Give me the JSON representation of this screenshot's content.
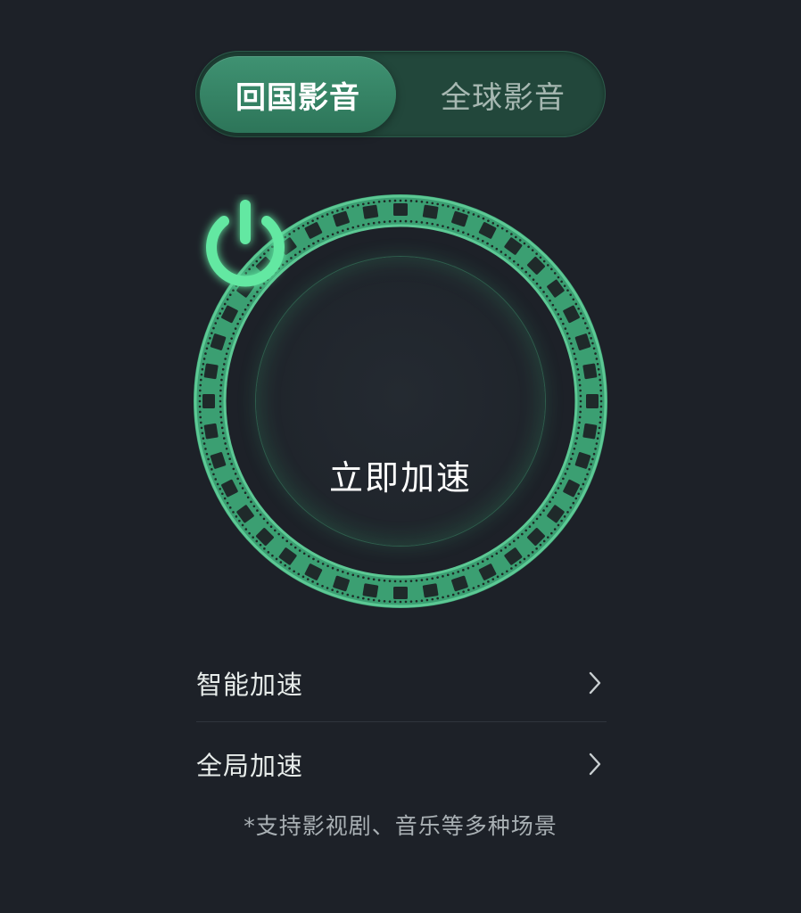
{
  "segmented": {
    "tabs": [
      {
        "label": "回国影音",
        "selected": true
      },
      {
        "label": "全球影音",
        "selected": false
      }
    ]
  },
  "dial": {
    "icon": "power-icon",
    "label": "立即加速"
  },
  "options": [
    {
      "label": "智能加速",
      "icon": "chevron-right-icon"
    },
    {
      "label": "全局加速",
      "icon": "chevron-right-icon"
    }
  ],
  "footnote": "*支持影视剧、音乐等多种场景",
  "colors": {
    "background": "#1d2128",
    "accent": "#5ee39b",
    "ring": "#3a9a6e",
    "segment_active": "#3a8a6a",
    "segment_track": "#22473b"
  }
}
